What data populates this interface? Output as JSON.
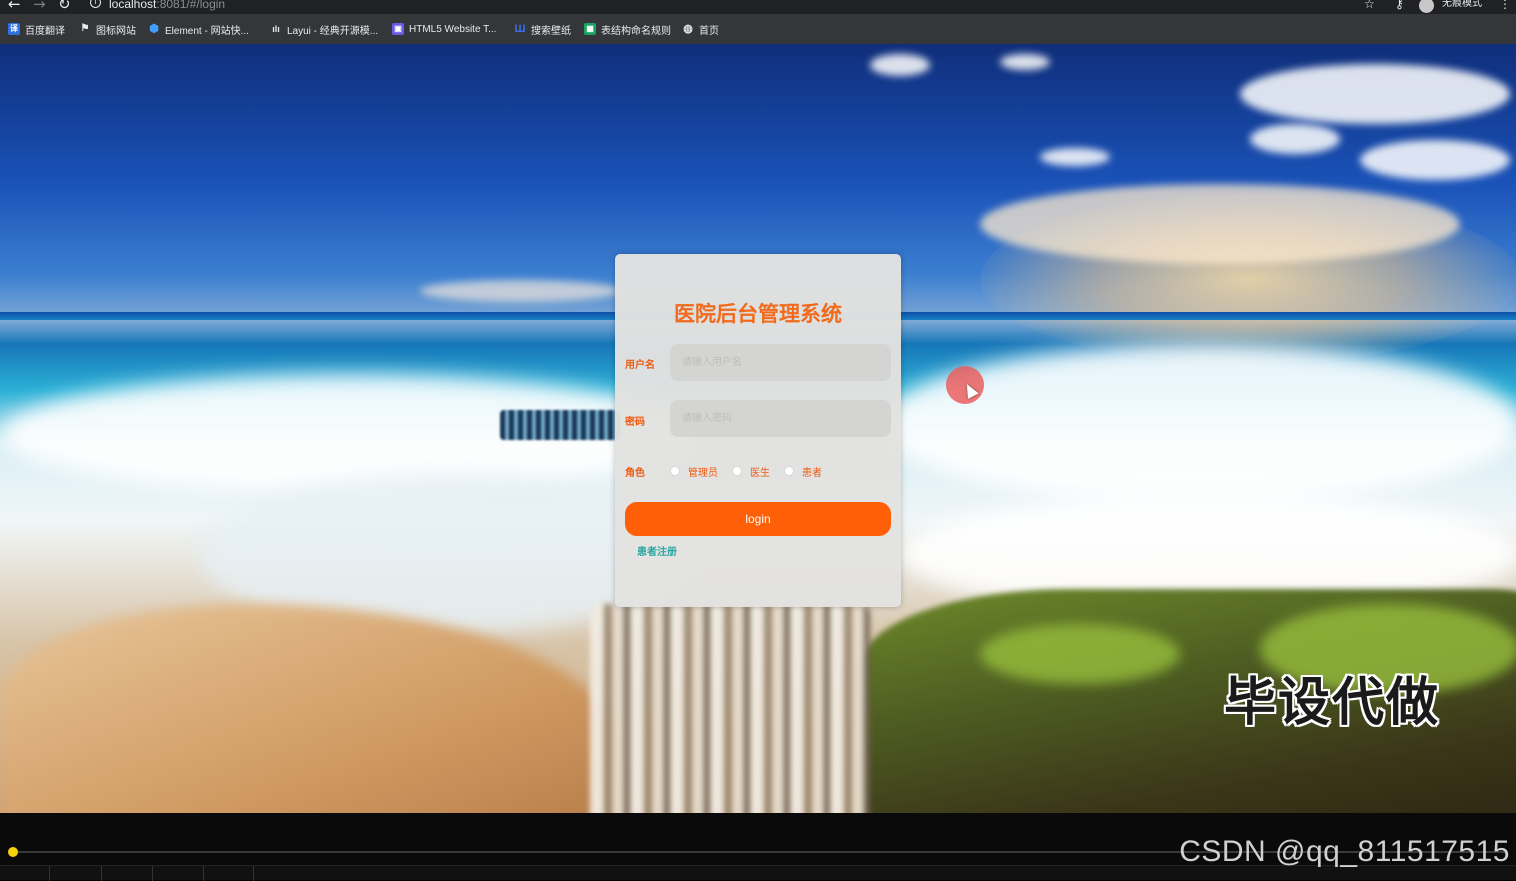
{
  "browser": {
    "url_host": "localhost",
    "url_path": ":8081/#/login",
    "incognito_label": "无痕模式",
    "icons": [
      "back-arrow-icon",
      "forward-arrow-icon",
      "reload-icon",
      "info-icon",
      "star-icon",
      "key-icon",
      "incognito-icon",
      "menu-dots-icon"
    ]
  },
  "bookmarks": [
    {
      "label": "百度翻译",
      "color": "#2f6fe0"
    },
    {
      "label": "图标网站",
      "color": "#e8eaed"
    },
    {
      "label": "Element - 网站快...",
      "color": "#409eff"
    },
    {
      "label": "Layui - 经典开源模...",
      "color": "#e8eaed"
    },
    {
      "label": "HTML5 Website T...",
      "color": "#6b5ce7"
    },
    {
      "label": "搜索壁纸",
      "color": "#3a6ee8"
    },
    {
      "label": "表结构命名规则",
      "color": "#1aa260"
    },
    {
      "label": "首页",
      "color": "#e8eaed"
    }
  ],
  "login": {
    "title": "医院后台管理系统",
    "username_label": "用户名",
    "username_placeholder": "请输入用户名",
    "password_label": "密码",
    "password_placeholder": "请输入密码",
    "role_label": "角色",
    "roles": [
      "管理员",
      "医生",
      "患者"
    ],
    "login_button": "login",
    "register_link": "患者注册"
  },
  "overlay": {
    "watermark": "毕设代做",
    "csdn_tag": "CSDN @qq_811517515"
  },
  "player": {
    "progress": 0.003
  },
  "colors": {
    "accent": "#ff5f06",
    "title": "#f26a1b",
    "link": "#2aa7a0",
    "progress": "#f5d20a"
  }
}
